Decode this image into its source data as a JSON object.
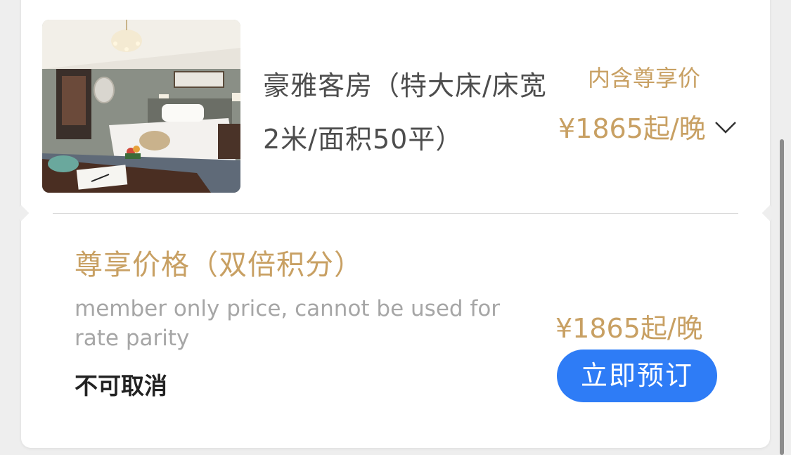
{
  "room": {
    "title": "豪雅客房（特大床/床宽2米/面积50平）",
    "member_price_label": "内含尊享价",
    "price": "¥1865起/晚",
    "expand_icon": "chevron-down-icon",
    "photo": "hotel-room-photo"
  },
  "rate": {
    "name": "尊享价格（双倍积分）",
    "description": "member only price, cannot be used for rate parity",
    "cancel_policy": "不可取消",
    "price": "¥1865起/晚",
    "book_label": "立即预订"
  },
  "colors": {
    "gold": "#c8a063",
    "primary_blue": "#2e7cf6",
    "title_gray": "#4d4d4d",
    "desc_gray": "#a6a6a6"
  }
}
